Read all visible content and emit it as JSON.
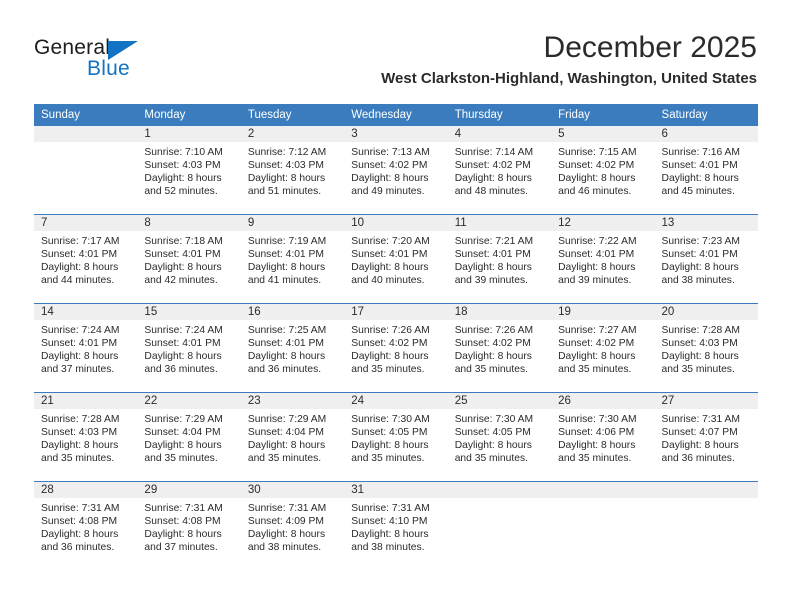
{
  "brand": {
    "name_part1": "General",
    "name_part2": "Blue",
    "triangle_icon": "triangle-icon",
    "accent_color": "#1273c4"
  },
  "header": {
    "month_title": "December 2025",
    "location": "West Clarkston-Highland, Washington, United States"
  },
  "calendar": {
    "header_color": "#3a7cbe",
    "daynum_band_color": "#efefef",
    "weekday_headers": [
      "Sunday",
      "Monday",
      "Tuesday",
      "Wednesday",
      "Thursday",
      "Friday",
      "Saturday"
    ],
    "weeks": [
      [
        {
          "day": "",
          "empty": true,
          "lines": []
        },
        {
          "day": "1",
          "empty": false,
          "lines": [
            "Sunrise: 7:10 AM",
            "Sunset: 4:03 PM",
            "Daylight: 8 hours",
            "and 52 minutes."
          ]
        },
        {
          "day": "2",
          "empty": false,
          "lines": [
            "Sunrise: 7:12 AM",
            "Sunset: 4:03 PM",
            "Daylight: 8 hours",
            "and 51 minutes."
          ]
        },
        {
          "day": "3",
          "empty": false,
          "lines": [
            "Sunrise: 7:13 AM",
            "Sunset: 4:02 PM",
            "Daylight: 8 hours",
            "and 49 minutes."
          ]
        },
        {
          "day": "4",
          "empty": false,
          "lines": [
            "Sunrise: 7:14 AM",
            "Sunset: 4:02 PM",
            "Daylight: 8 hours",
            "and 48 minutes."
          ]
        },
        {
          "day": "5",
          "empty": false,
          "lines": [
            "Sunrise: 7:15 AM",
            "Sunset: 4:02 PM",
            "Daylight: 8 hours",
            "and 46 minutes."
          ]
        },
        {
          "day": "6",
          "empty": false,
          "lines": [
            "Sunrise: 7:16 AM",
            "Sunset: 4:01 PM",
            "Daylight: 8 hours",
            "and 45 minutes."
          ]
        }
      ],
      [
        {
          "day": "7",
          "empty": false,
          "lines": [
            "Sunrise: 7:17 AM",
            "Sunset: 4:01 PM",
            "Daylight: 8 hours",
            "and 44 minutes."
          ]
        },
        {
          "day": "8",
          "empty": false,
          "lines": [
            "Sunrise: 7:18 AM",
            "Sunset: 4:01 PM",
            "Daylight: 8 hours",
            "and 42 minutes."
          ]
        },
        {
          "day": "9",
          "empty": false,
          "lines": [
            "Sunrise: 7:19 AM",
            "Sunset: 4:01 PM",
            "Daylight: 8 hours",
            "and 41 minutes."
          ]
        },
        {
          "day": "10",
          "empty": false,
          "lines": [
            "Sunrise: 7:20 AM",
            "Sunset: 4:01 PM",
            "Daylight: 8 hours",
            "and 40 minutes."
          ]
        },
        {
          "day": "11",
          "empty": false,
          "lines": [
            "Sunrise: 7:21 AM",
            "Sunset: 4:01 PM",
            "Daylight: 8 hours",
            "and 39 minutes."
          ]
        },
        {
          "day": "12",
          "empty": false,
          "lines": [
            "Sunrise: 7:22 AM",
            "Sunset: 4:01 PM",
            "Daylight: 8 hours",
            "and 39 minutes."
          ]
        },
        {
          "day": "13",
          "empty": false,
          "lines": [
            "Sunrise: 7:23 AM",
            "Sunset: 4:01 PM",
            "Daylight: 8 hours",
            "and 38 minutes."
          ]
        }
      ],
      [
        {
          "day": "14",
          "empty": false,
          "lines": [
            "Sunrise: 7:24 AM",
            "Sunset: 4:01 PM",
            "Daylight: 8 hours",
            "and 37 minutes."
          ]
        },
        {
          "day": "15",
          "empty": false,
          "lines": [
            "Sunrise: 7:24 AM",
            "Sunset: 4:01 PM",
            "Daylight: 8 hours",
            "and 36 minutes."
          ]
        },
        {
          "day": "16",
          "empty": false,
          "lines": [
            "Sunrise: 7:25 AM",
            "Sunset: 4:01 PM",
            "Daylight: 8 hours",
            "and 36 minutes."
          ]
        },
        {
          "day": "17",
          "empty": false,
          "lines": [
            "Sunrise: 7:26 AM",
            "Sunset: 4:02 PM",
            "Daylight: 8 hours",
            "and 35 minutes."
          ]
        },
        {
          "day": "18",
          "empty": false,
          "lines": [
            "Sunrise: 7:26 AM",
            "Sunset: 4:02 PM",
            "Daylight: 8 hours",
            "and 35 minutes."
          ]
        },
        {
          "day": "19",
          "empty": false,
          "lines": [
            "Sunrise: 7:27 AM",
            "Sunset: 4:02 PM",
            "Daylight: 8 hours",
            "and 35 minutes."
          ]
        },
        {
          "day": "20",
          "empty": false,
          "lines": [
            "Sunrise: 7:28 AM",
            "Sunset: 4:03 PM",
            "Daylight: 8 hours",
            "and 35 minutes."
          ]
        }
      ],
      [
        {
          "day": "21",
          "empty": false,
          "lines": [
            "Sunrise: 7:28 AM",
            "Sunset: 4:03 PM",
            "Daylight: 8 hours",
            "and 35 minutes."
          ]
        },
        {
          "day": "22",
          "empty": false,
          "lines": [
            "Sunrise: 7:29 AM",
            "Sunset: 4:04 PM",
            "Daylight: 8 hours",
            "and 35 minutes."
          ]
        },
        {
          "day": "23",
          "empty": false,
          "lines": [
            "Sunrise: 7:29 AM",
            "Sunset: 4:04 PM",
            "Daylight: 8 hours",
            "and 35 minutes."
          ]
        },
        {
          "day": "24",
          "empty": false,
          "lines": [
            "Sunrise: 7:30 AM",
            "Sunset: 4:05 PM",
            "Daylight: 8 hours",
            "and 35 minutes."
          ]
        },
        {
          "day": "25",
          "empty": false,
          "lines": [
            "Sunrise: 7:30 AM",
            "Sunset: 4:05 PM",
            "Daylight: 8 hours",
            "and 35 minutes."
          ]
        },
        {
          "day": "26",
          "empty": false,
          "lines": [
            "Sunrise: 7:30 AM",
            "Sunset: 4:06 PM",
            "Daylight: 8 hours",
            "and 35 minutes."
          ]
        },
        {
          "day": "27",
          "empty": false,
          "lines": [
            "Sunrise: 7:31 AM",
            "Sunset: 4:07 PM",
            "Daylight: 8 hours",
            "and 36 minutes."
          ]
        }
      ],
      [
        {
          "day": "28",
          "empty": false,
          "lines": [
            "Sunrise: 7:31 AM",
            "Sunset: 4:08 PM",
            "Daylight: 8 hours",
            "and 36 minutes."
          ]
        },
        {
          "day": "29",
          "empty": false,
          "lines": [
            "Sunrise: 7:31 AM",
            "Sunset: 4:08 PM",
            "Daylight: 8 hours",
            "and 37 minutes."
          ]
        },
        {
          "day": "30",
          "empty": false,
          "lines": [
            "Sunrise: 7:31 AM",
            "Sunset: 4:09 PM",
            "Daylight: 8 hours",
            "and 38 minutes."
          ]
        },
        {
          "day": "31",
          "empty": false,
          "lines": [
            "Sunrise: 7:31 AM",
            "Sunset: 4:10 PM",
            "Daylight: 8 hours",
            "and 38 minutes."
          ]
        },
        {
          "day": "",
          "empty": true,
          "lines": []
        },
        {
          "day": "",
          "empty": true,
          "lines": []
        },
        {
          "day": "",
          "empty": true,
          "lines": []
        }
      ]
    ]
  }
}
